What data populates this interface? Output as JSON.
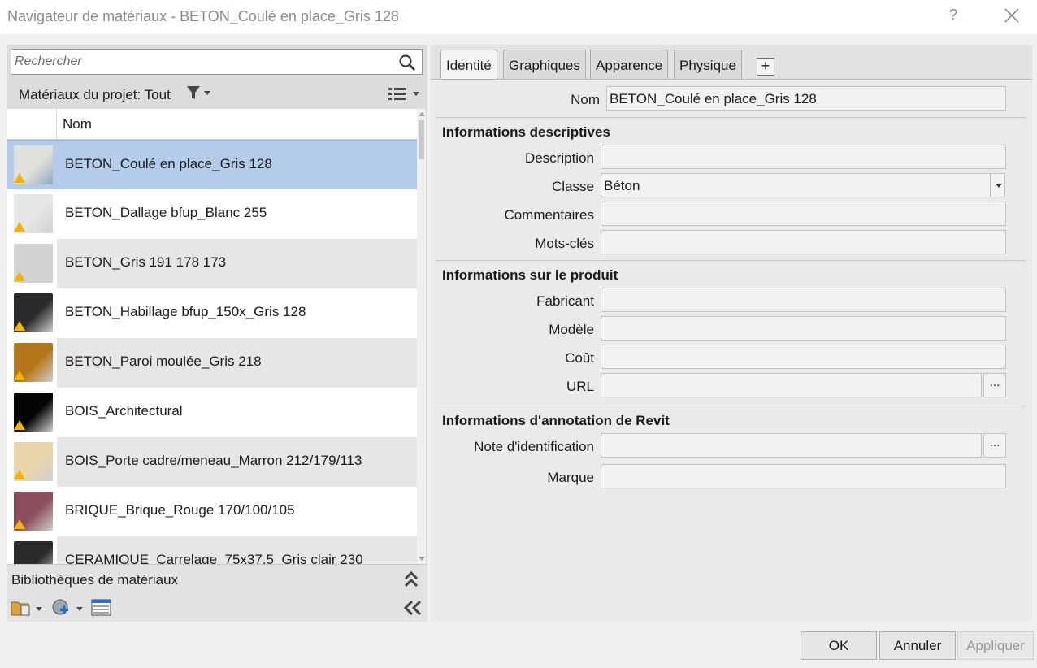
{
  "window": {
    "title": "Navigateur de matériaux - BETON_Coulé en place_Gris 128",
    "help_label": "?"
  },
  "search": {
    "placeholder": "Rechercher"
  },
  "project": {
    "label": "Matériaux du projet: Tout"
  },
  "list": {
    "column_header": "Nom",
    "items": [
      {
        "name": "BETON_Coulé en place_Gris 128",
        "selected": true,
        "swatch": "#e0e0dc"
      },
      {
        "name": "BETON_Dallage bfup_Blanc 255",
        "selected": false,
        "swatch": "#e6e6e6"
      },
      {
        "name": "BETON_Gris 191 178 173",
        "selected": false,
        "swatch": "#d2d2d2"
      },
      {
        "name": "BETON_Habillage bfup_150x_Gris 128",
        "selected": false,
        "swatch": "#2a2a2a"
      },
      {
        "name": "BETON_Paroi moulée_Gris 218",
        "selected": false,
        "swatch": "#b5761a"
      },
      {
        "name": "BOIS_Architectural",
        "selected": false,
        "swatch": "#050505"
      },
      {
        "name": "BOIS_Porte cadre/meneau_Marron 212/179/113",
        "selected": false,
        "swatch": "#e8d4a8"
      },
      {
        "name": "BRIQUE_Brique_Rouge 170/100/105",
        "selected": false,
        "swatch": "#8a4f5a"
      },
      {
        "name": "CERAMIQUE_Carrelage_75x37.5_Gris clair 230",
        "selected": false,
        "swatch": "#2a2a2a"
      }
    ]
  },
  "library": {
    "label": "Bibliothèques de matériaux"
  },
  "tabs": [
    {
      "label": "Identité",
      "active": true
    },
    {
      "label": "Graphiques",
      "active": false
    },
    {
      "label": "Apparence",
      "active": false
    },
    {
      "label": "Physique",
      "active": false
    }
  ],
  "tab_add_label": "+",
  "form": {
    "name_label": "Nom",
    "name_value": "BETON_Coulé en place_Gris 128",
    "descriptive": {
      "title": "Informations descriptives",
      "description_label": "Description",
      "description_value": "",
      "class_label": "Classe",
      "class_value": "Béton",
      "comments_label": "Commentaires",
      "comments_value": "",
      "keywords_label": "Mots-clés",
      "keywords_value": ""
    },
    "product": {
      "title": "Informations sur le produit",
      "manufacturer_label": "Fabricant",
      "manufacturer_value": "",
      "model_label": "Modèle",
      "model_value": "",
      "cost_label": "Coût",
      "cost_value": "",
      "url_label": "URL",
      "url_value": "",
      "browse_label": "..."
    },
    "annotation": {
      "title": "Informations d'annotation de Revit",
      "keynote_label": "Note d'identification",
      "keynote_value": "",
      "keynote_browse_label": "...",
      "mark_label": "Marque",
      "mark_value": ""
    }
  },
  "buttons": {
    "ok": "OK",
    "cancel": "Annuler",
    "apply": "Appliquer"
  },
  "colors": {
    "selection": "#b4cce9",
    "warning": "#f4b300"
  }
}
